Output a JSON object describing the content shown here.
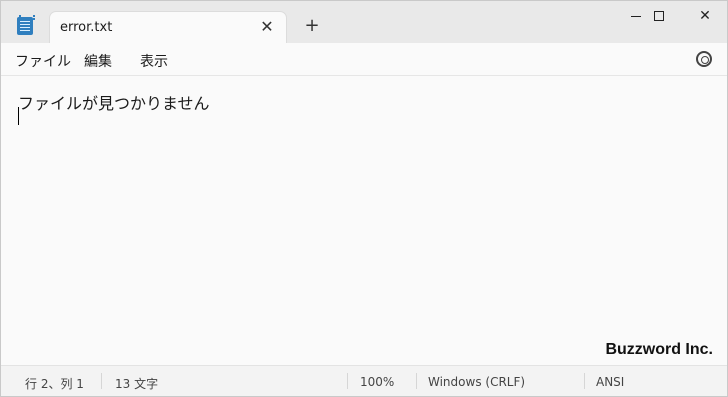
{
  "tab": {
    "title": "error.txt",
    "close_glyph": "✕",
    "new_tab_glyph": "+"
  },
  "window_controls": {
    "minimize_icon": "minimize-icon",
    "maximize_icon": "maximize-icon",
    "close_glyph": "✕"
  },
  "menu": {
    "file": "ファイル",
    "edit": "編集",
    "view": "表示",
    "settings_icon": "gear-icon"
  },
  "editor": {
    "lines": [
      "ファイルが見つかりません",
      ""
    ]
  },
  "watermark": "Buzzword Inc.",
  "status": {
    "position": "行 2、列 1",
    "char_count": "13 文字",
    "zoom": "100%",
    "line_ending": "Windows (CRLF)",
    "encoding": "ANSI"
  },
  "colors": {
    "app_icon": "#2f7fbf",
    "background": "#fafafa",
    "titlebar": "#e9e9e9"
  }
}
